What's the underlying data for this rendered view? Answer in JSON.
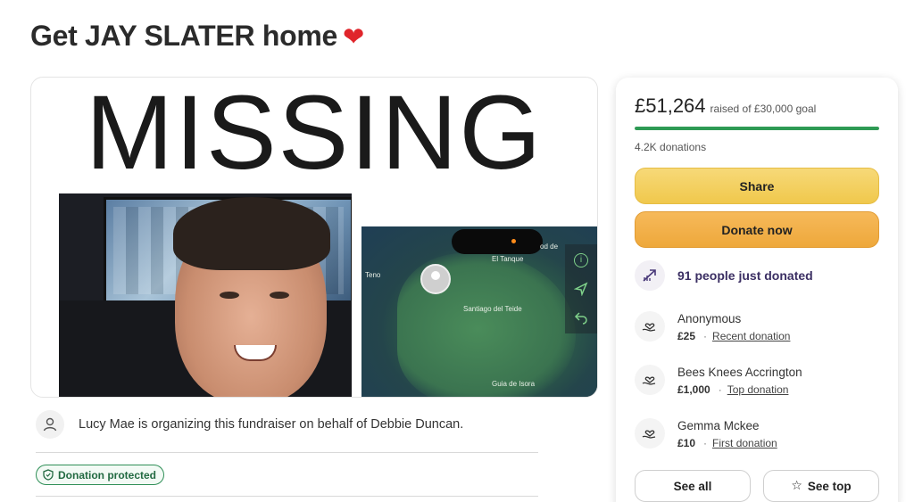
{
  "page": {
    "title": "Get JAY SLATER home",
    "title_emoji": "❤"
  },
  "hero": {
    "headline": "MISSING",
    "map": {
      "label_santiago": "Santiago del Teide",
      "label_guia": "Guia de Isora",
      "label_top": "El Tanque",
      "label_left": "Teno",
      "label_corner": "od de"
    }
  },
  "organizer": {
    "text": "Lucy Mae is organizing this fundraiser on behalf of Debbie Duncan."
  },
  "badge": {
    "label": "Donation protected"
  },
  "sidebar": {
    "amount": "£51,264",
    "goal_text": "raised of £30,000 goal",
    "progress_fraction": 1.0,
    "donations_count": "4.2K donations",
    "share_label": "Share",
    "donate_label": "Donate now",
    "recent_activity": "91 people just donated",
    "donors": [
      {
        "name": "Anonymous",
        "amount": "£25",
        "tag": "Recent donation"
      },
      {
        "name": "Bees Knees Accrington",
        "amount": "£1,000",
        "tag": "Top donation"
      },
      {
        "name": "Gemma Mckee",
        "amount": "£10",
        "tag": "First donation"
      }
    ],
    "see_all_label": "See all",
    "see_top_label": "See top"
  },
  "colors": {
    "progress": "#2e9a54",
    "share_button": "#f0c84c",
    "donate_button": "#eea83b",
    "badge_green": "#2f8f57",
    "activity_text": "#3b2f63"
  }
}
